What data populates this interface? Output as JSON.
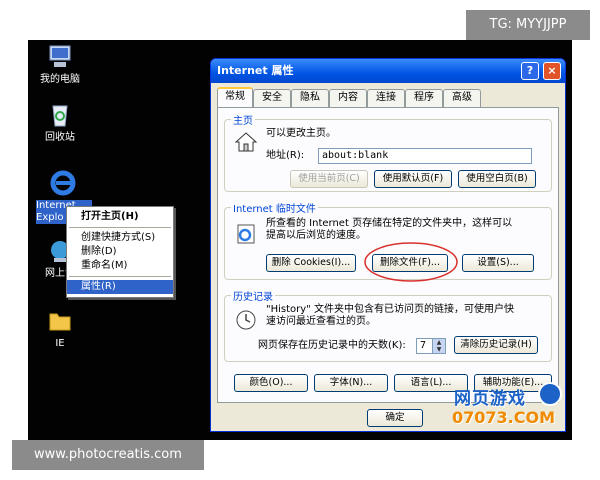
{
  "watermark_top": "TG: MYYJJPP",
  "watermark_bottom": "www.photocreatis.com",
  "desktop": {
    "icons": [
      {
        "label": "我的电脑"
      },
      {
        "label": "回收站"
      },
      {
        "label1": "Internet",
        "label2": "Explo"
      },
      {
        "label": "网上邻"
      },
      {
        "label": "IE"
      }
    ]
  },
  "context_menu": {
    "items": [
      "打开主页(H)",
      "创建快捷方式(S)",
      "删除(D)",
      "重命名(M)",
      "属性(R)"
    ]
  },
  "dialog": {
    "title": "Internet 属性",
    "help": "?",
    "close": "×",
    "tabs": [
      "常规",
      "安全",
      "隐私",
      "内容",
      "连接",
      "程序",
      "高级"
    ],
    "home": {
      "legend": "主页",
      "desc": "可以更改主页。",
      "addr_label": "地址(R):",
      "addr_value": "about:blank",
      "btn_current": "使用当前页(C)",
      "btn_default": "使用默认页(F)",
      "btn_blank": "使用空白页(B)"
    },
    "temp": {
      "legend": "Internet 临时文件",
      "desc1": "所查看的 Internet 页存储在特定的文件夹中，这样可以",
      "desc2": "提高以后浏览的速度。",
      "btn_cookies": "删除 Cookies(I)...",
      "btn_files": "删除文件(F)...",
      "btn_settings": "设置(S)..."
    },
    "history": {
      "legend": "历史记录",
      "desc1": "\"History\" 文件夹中包含有已访问页的链接，可使用户快",
      "desc2": "速访问最近查看过的页。",
      "days_label": "网页保存在历史记录中的天数(K):",
      "days_value": "7",
      "btn_clear": "清除历史记录(H)"
    },
    "bottom": {
      "btn_colors": "颜色(O)...",
      "btn_fonts": "字体(N)...",
      "btn_lang": "语言(L)...",
      "btn_access": "辅助功能(E)..."
    },
    "ok": "确定"
  },
  "logo": {
    "line1": "网页游戏",
    "line2": "07073.COM"
  },
  "colors": {
    "annotation_circle": "#d9302c",
    "logo_orange": "#f08a00",
    "logo_blue": "#1d63c7"
  }
}
